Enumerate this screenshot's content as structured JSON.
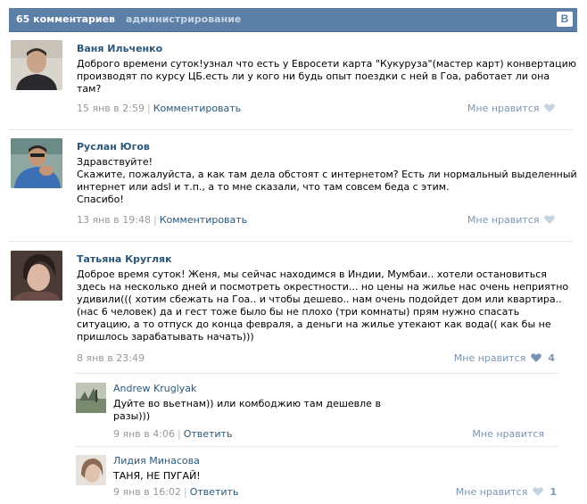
{
  "header": {
    "comments_count": "65 комментариев",
    "admin_label": "администрирование",
    "vk_logo": "B"
  },
  "comments": [
    {
      "author": "Ваня Ильченко",
      "lines": [
        "Доброго времени суток!узнал что есть у Евросети карта \"Кукуруза\"(мастер карт) конвертацию",
        "производят по курсу ЦБ.есть ли у кого ни будь опыт поездки с ней в Гоа, работает ли она",
        "там?"
      ],
      "date": "15 янв в 2:59",
      "action": "Комментировать",
      "like_label": "Мне нравится",
      "like_count": ""
    },
    {
      "author": "Руслан Югов",
      "lines": [
        "Здравствуйте!",
        "Скажите, пожалуйста, а как там дела обстоят с интернетом? Есть ли нормальный выделенный",
        "интернет или adsl и т.п., а то мне сказали, что там совсем беда с этим.",
        "Спасибо!"
      ],
      "date": "13 янв в 19:48",
      "action": "Комментировать",
      "like_label": "Мне нравится",
      "like_count": ""
    },
    {
      "author": "Татьяна Кругляк",
      "lines": [
        "Доброе время суток! Женя, мы сейчас находимся в Индии, Мумбаи.. хотели остановиться",
        "здесь на несколько дней и посмотреть окрестности... но цены на жилье нас очень неприятно",
        "удивили((( хотим сбежать на Гоа.. и чтобы дешево.. нам очень подойдет дом или квартира..",
        "(нас 6 человек) да и гест тоже было бы не плохо (три комнаты) прям нужно спасать",
        "ситуацию, а то отпуск до конца февраля, а деньги на жилье утекают как вода(( как бы не",
        "пришлось зарабатывать начать)))"
      ],
      "date": "8 янв в 23:49",
      "action": "",
      "like_label": "Мне нравится",
      "like_count": "4"
    }
  ],
  "replies": [
    {
      "author": "Andrew Kruglyak",
      "lines": [
        "Дуйте во вьетнам)) или комбоджию там дешевле в",
        "разы)))"
      ],
      "date": "9 янв в 4:06",
      "action": "Ответить",
      "like_label": "Мне нравится",
      "like_count": ""
    },
    {
      "author": "Лидия Минасова",
      "lines": [
        "ТАНЯ, НЕ ПУГАЙ!"
      ],
      "date": "9 янв в 16:02",
      "action": "Ответить",
      "like_label": "Мне нравится",
      "like_count": "1"
    }
  ],
  "colors": {
    "header_bg": "#5b7fa6",
    "link": "#2b587a",
    "meta": "#999999",
    "like": "#7b95b3"
  }
}
